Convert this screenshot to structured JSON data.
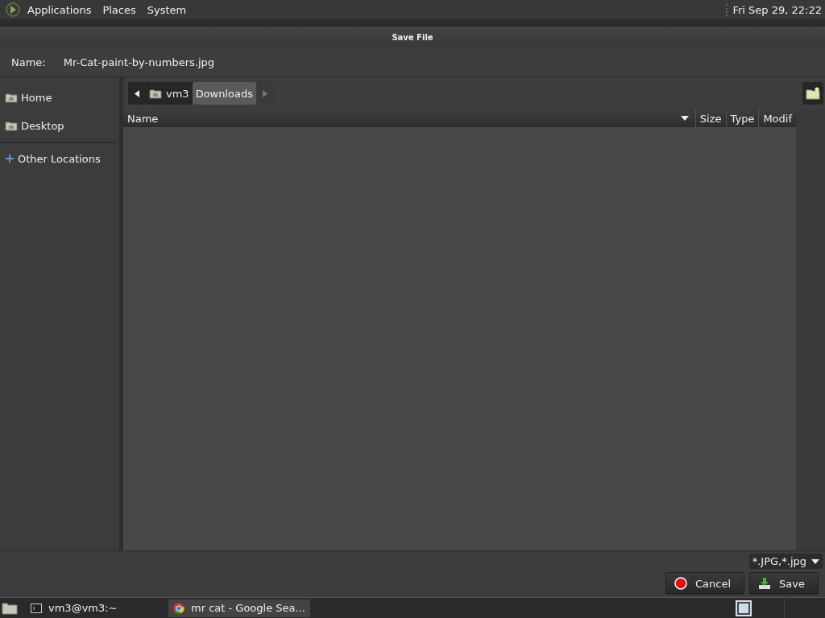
{
  "top_panel": {
    "menus": [
      "Applications",
      "Places",
      "System"
    ],
    "clock": "Fri Sep 29, 22:22"
  },
  "window": {
    "title": "Save File"
  },
  "name_field": {
    "label": "Name:",
    "value": "Mr-Cat-paint-by-numbers.jpg"
  },
  "sidebar": {
    "items": [
      {
        "label": "Home",
        "kind": "home"
      },
      {
        "label": "Desktop",
        "kind": "desktop"
      },
      {
        "label": "Other Locations",
        "kind": "network"
      }
    ]
  },
  "breadcrumb": [
    {
      "label": "vm3",
      "kind": "home",
      "selected": false
    },
    {
      "label": "Downloads",
      "kind": "folder",
      "selected": true
    }
  ],
  "table": {
    "columns": [
      "Name",
      "Size",
      "Type",
      "Modif"
    ]
  },
  "filter": {
    "value": "*.JPG,*.jpg"
  },
  "buttons": [
    {
      "label": "Cancel",
      "kind": "cancel"
    },
    {
      "label": "Save",
      "kind": "save"
    }
  ],
  "taskbar": {
    "items": [
      {
        "label": "vm3@vm3:~",
        "kind": "terminal",
        "selected": false
      },
      {
        "label": "mr cat - Google Sea...",
        "kind": "browser",
        "selected": true
      }
    ]
  }
}
